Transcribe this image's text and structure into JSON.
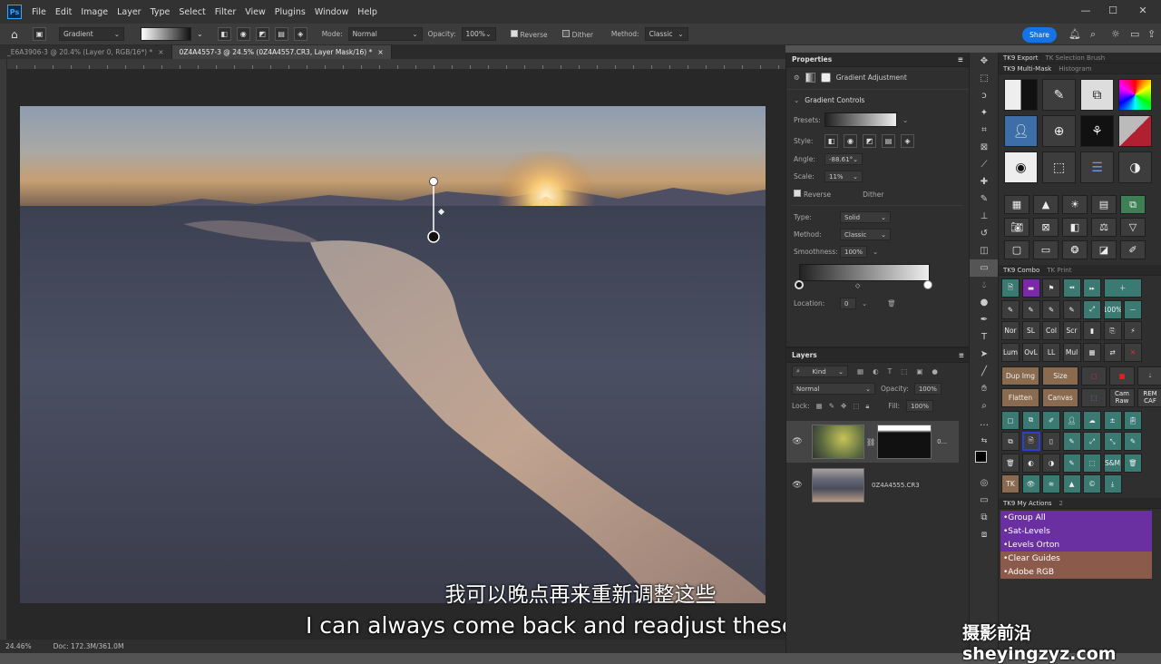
{
  "menubar": {
    "logo": "Ps",
    "items": [
      "File",
      "Edit",
      "Image",
      "Layer",
      "Type",
      "Select",
      "Filter",
      "View",
      "Plugins",
      "Window",
      "Help"
    ],
    "win_minimize": "—",
    "win_maximize": "☐",
    "win_close": "✕"
  },
  "options": {
    "tool_name": "Gradient",
    "mode_label": "Mode:",
    "mode_value": "Normal",
    "opacity_label": "Opacity:",
    "opacity_value": "100%",
    "reverse_label": "Reverse",
    "dither_label": "Dither",
    "method_label": "Method:",
    "method_value": "Classic",
    "share_label": "Share"
  },
  "tabs": [
    {
      "label": "_E6A3906-3 @ 20.4% (Layer 0, RGB/16*) *"
    },
    {
      "label": "0Z4A4557-3 @ 24.5% (0Z4A4557.CR3, Layer Mask/16) *"
    }
  ],
  "status": {
    "zoom": "24.46%",
    "doc": "Doc: 172.3M/361.0M"
  },
  "subtitles": {
    "cn": "我可以晚点再来重新调整这些",
    "en": "I can always come back and readjust these later"
  },
  "properties": {
    "title": "Properties",
    "section_label": "Gradient Adjustment",
    "controls_title": "Gradient Controls",
    "presets_label": "Presets:",
    "style_label": "Style:",
    "angle_label": "Angle:",
    "angle_value": "-88.61°",
    "scale_label": "Scale:",
    "scale_value": "11%",
    "reverse_label": "Reverse",
    "dither_label": "Dither",
    "type_label": "Type:",
    "type_value": "Solid",
    "method_label": "Method:",
    "method_value": "Classic",
    "smoothness_label": "Smoothness:",
    "smoothness_value": "100%",
    "location_label": "Location:",
    "location_value": "0"
  },
  "layers": {
    "title": "Layers",
    "kind_label": "Kind",
    "blend_value": "Normal",
    "opacity_label": "Opacity:",
    "opacity_value": "100%",
    "lock_label": "Lock:",
    "fill_label": "Fill:",
    "fill_value": "100%",
    "layer1_name": "0...",
    "layer2_name": "0Z4A4555.CR3"
  },
  "tk": {
    "export_tab": "TK9 Export",
    "selection_tab": "TK Selection Brush",
    "multimask_tab": "TK9 Multi-Mask",
    "histogram_tab": "Histogram",
    "combo_tab": "TK9 Combo",
    "print_tab": "TK Print",
    "combo_labels": [
      "Nor",
      "SL",
      "Col",
      "Scr",
      "Lum",
      "OvL",
      "LL",
      "Mul"
    ],
    "dup_img": "Dup Img",
    "size": "Size",
    "flatten": "Flatten",
    "canvas": "Canvas",
    "cam_raw": "Cam Raw",
    "rem_caf": "REM CAF",
    "pct": "100%",
    "sm": "S&M",
    "tk_label": "TK",
    "actions_tab": "TK9 My Actions",
    "actions_count": "2",
    "actions": [
      "•Group All",
      "•Sat-Levels",
      "•Levels Orton",
      "•Clear Guides",
      "•Adobe RGB"
    ]
  },
  "watermark": "摄影前沿sheyingzyz.com",
  "colors": {
    "accent": "#1473e6",
    "action_purple": "#6a2fa0",
    "action_tan": "#8c5a4a"
  }
}
